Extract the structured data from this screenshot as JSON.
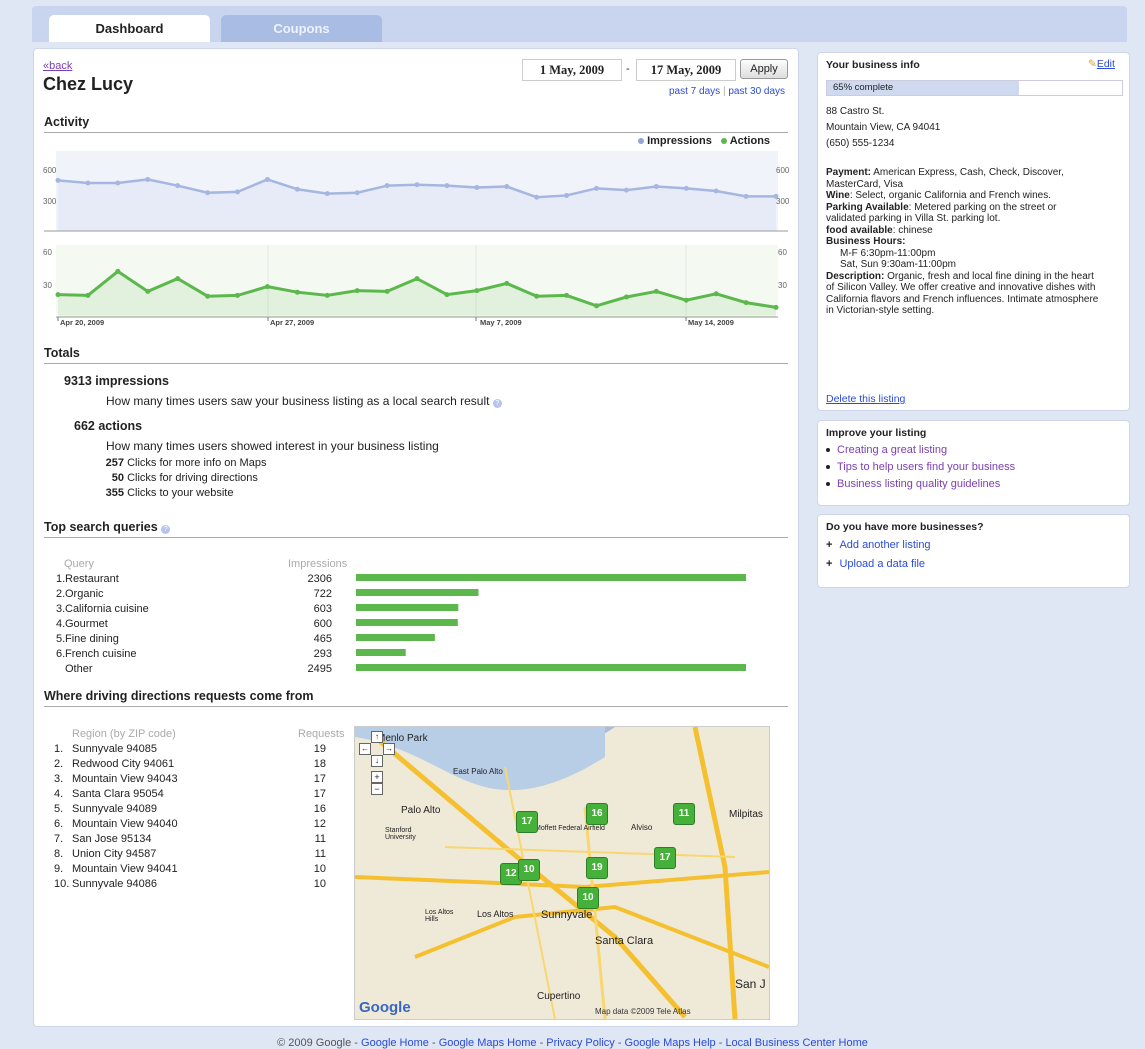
{
  "tabs": [
    {
      "label": "Dashboard"
    },
    {
      "label": "Coupons"
    }
  ],
  "header": {
    "back_label": "«back",
    "business_name": "Chez Lucy",
    "date_from": "1 May, 2009",
    "date_sep": "-",
    "date_to": "17 May, 2009",
    "apply_label": "Apply",
    "past7_label": "past 7 days",
    "range_sep": "|",
    "past30_label": "past 30 days"
  },
  "activity": {
    "heading": "Activity",
    "legend": [
      {
        "label": "Impressions",
        "color": "#8fa6da"
      },
      {
        "label": "Actions",
        "color": "#5cb84c"
      }
    ]
  },
  "chart_data": [
    {
      "type": "line",
      "series": [
        {
          "name": "Impressions",
          "color": "#a5b6e0",
          "values": [
            570,
            540,
            540,
            580,
            510,
            430,
            440,
            580,
            470,
            420,
            430,
            510,
            520,
            510,
            490,
            500,
            380,
            400,
            480,
            460,
            500,
            480,
            450,
            390,
            390
          ]
        }
      ],
      "ylim": [
        0,
        900
      ],
      "yticks": [
        "600",
        "300"
      ],
      "yticks_right": [
        "600",
        "300"
      ]
    },
    {
      "type": "line",
      "series": [
        {
          "name": "Actions",
          "color": "#5cb84c",
          "values": [
            28,
            27,
            57,
            32,
            48,
            26,
            27,
            38,
            31,
            27,
            33,
            32,
            48,
            28,
            33,
            42,
            26,
            27,
            14,
            25,
            32,
            21,
            29,
            18,
            12
          ]
        }
      ],
      "ylim": [
        0,
        90
      ],
      "yticks": [
        "60",
        "30"
      ],
      "yticks_right": [
        "60",
        "30"
      ],
      "x_labels": [
        "Apr 20, 2009",
        "Apr 27, 2009",
        "May 7, 2009",
        "May 14, 2009"
      ]
    },
    {
      "type": "bar",
      "categories": [
        "Restaurant",
        "Organic",
        "California cuisine",
        "Gourmet",
        "Fine dining",
        "French cuisine",
        "Other"
      ],
      "values": [
        2306,
        722,
        603,
        600,
        465,
        293,
        2495
      ],
      "xlim": [
        0,
        2800
      ]
    }
  ],
  "totals": {
    "heading": "Totals",
    "impressions_count": "9313",
    "impressions_label": "impressions",
    "impressions_desc": "How many times users saw your business listing as a local search result",
    "actions_count": "662",
    "actions_label": "actions",
    "actions_desc": "How many times users showed interest in your business listing",
    "breakdown": [
      {
        "count": "257",
        "label": "Clicks for more info on Maps"
      },
      {
        "count": "50",
        "label": "Clicks for driving directions"
      },
      {
        "count": "355",
        "label": "Clicks to your website"
      }
    ]
  },
  "queries": {
    "heading": "Top search queries",
    "col_query": "Query",
    "col_impressions": "Impressions",
    "rows": [
      {
        "rank": "1.",
        "query": "Restaurant",
        "impressions": "2306"
      },
      {
        "rank": "2.",
        "query": "Organic",
        "impressions": "722"
      },
      {
        "rank": "3.",
        "query": "California cuisine",
        "impressions": "603"
      },
      {
        "rank": "4.",
        "query": "Gourmet",
        "impressions": "600"
      },
      {
        "rank": "5.",
        "query": "Fine dining",
        "impressions": "465"
      },
      {
        "rank": "6.",
        "query": "French cuisine",
        "impressions": "293"
      },
      {
        "rank": "",
        "query": "Other",
        "impressions": "2495"
      }
    ]
  },
  "directions": {
    "heading": "Where driving directions requests come from",
    "col_region": "Region (by ZIP code)",
    "col_requests": "Requests",
    "rows": [
      {
        "rank": "1.",
        "region": "Sunnyvale 94085",
        "requests": "19"
      },
      {
        "rank": "2.",
        "region": "Redwood City 94061",
        "requests": "18"
      },
      {
        "rank": "3.",
        "region": "Mountain View 94043",
        "requests": "17"
      },
      {
        "rank": "4.",
        "region": "Santa Clara 95054",
        "requests": "17"
      },
      {
        "rank": "5.",
        "region": "Sunnyvale 94089",
        "requests": "16"
      },
      {
        "rank": "6.",
        "region": "Mountain View 94040",
        "requests": "12"
      },
      {
        "rank": "7.",
        "region": "San Jose 95134",
        "requests": "11"
      },
      {
        "rank": "8.",
        "region": "Union City 94587",
        "requests": "11"
      },
      {
        "rank": "9.",
        "region": "Mountain View 94041",
        "requests": "10"
      },
      {
        "rank": "10.",
        "region": "Sunnyvale 94086",
        "requests": "10"
      }
    ]
  },
  "map": {
    "places": [
      "Menlo Park",
      "Palo Alto",
      "East Palo Alto",
      "Stanford University",
      "Moffett Federal Airfield",
      "Alviso",
      "Milpitas",
      "Sunnyvale",
      "Los Altos",
      "Los Altos Hills",
      "Santa Clara",
      "Cupertino",
      "San J"
    ],
    "markers": [
      "17",
      "16",
      "11",
      "17",
      "12",
      "10",
      "19",
      "10"
    ],
    "attribution": "Map data ©2009 Tele Atlas",
    "logo": "Google"
  },
  "business_info": {
    "heading": "Your business info",
    "edit_label": "Edit",
    "progress_label": "65% complete",
    "progress_pct": 65,
    "address1": "88 Castro St.",
    "address2": "Mountain View, CA 94041",
    "phone": "(650) 555-1234",
    "payment_key": "Payment:",
    "payment_val": " American Express, Cash, Check, Discover,",
    "payment_val2": "MasterCard, Visa",
    "wine_key": "Wine",
    "wine_val": ": Select, organic California and French wines.",
    "parking_key": "Parking Available",
    "parking_val": ": Metered parking on the street or",
    "parking_val2": "validated parking in Villa St. parking lot.",
    "food_key": "food available",
    "food_val": ": chinese",
    "hours_key": "Business Hours:",
    "hours1": "M-F 6:30pm-11:00pm",
    "hours2": "Sat, Sun 9:30am-11:00pm",
    "desc_key": "Description:",
    "desc_val": " Organic, fresh and local fine dining in the heart",
    "desc_val2": "of Silicon Valley. We offer creative and innovative dishes with",
    "desc_val3": "California flavors and French influences. Intimate atmosphere",
    "desc_val4": "in Victorian-style setting.",
    "delete_label": "Delete this listing"
  },
  "improve": {
    "heading": "Improve your listing",
    "links": [
      "Creating a great listing",
      "Tips to help users find your business",
      "Business listing quality guidelines"
    ]
  },
  "more": {
    "heading": "Do you have more businesses?",
    "links": [
      "Add another listing",
      "Upload a data file"
    ]
  },
  "footer": {
    "copyright": "© 2009 Google",
    "links": [
      "Google Home",
      "Google Maps Home",
      "Privacy Policy",
      "Google Maps Help",
      "Local Business Center Home"
    ]
  }
}
